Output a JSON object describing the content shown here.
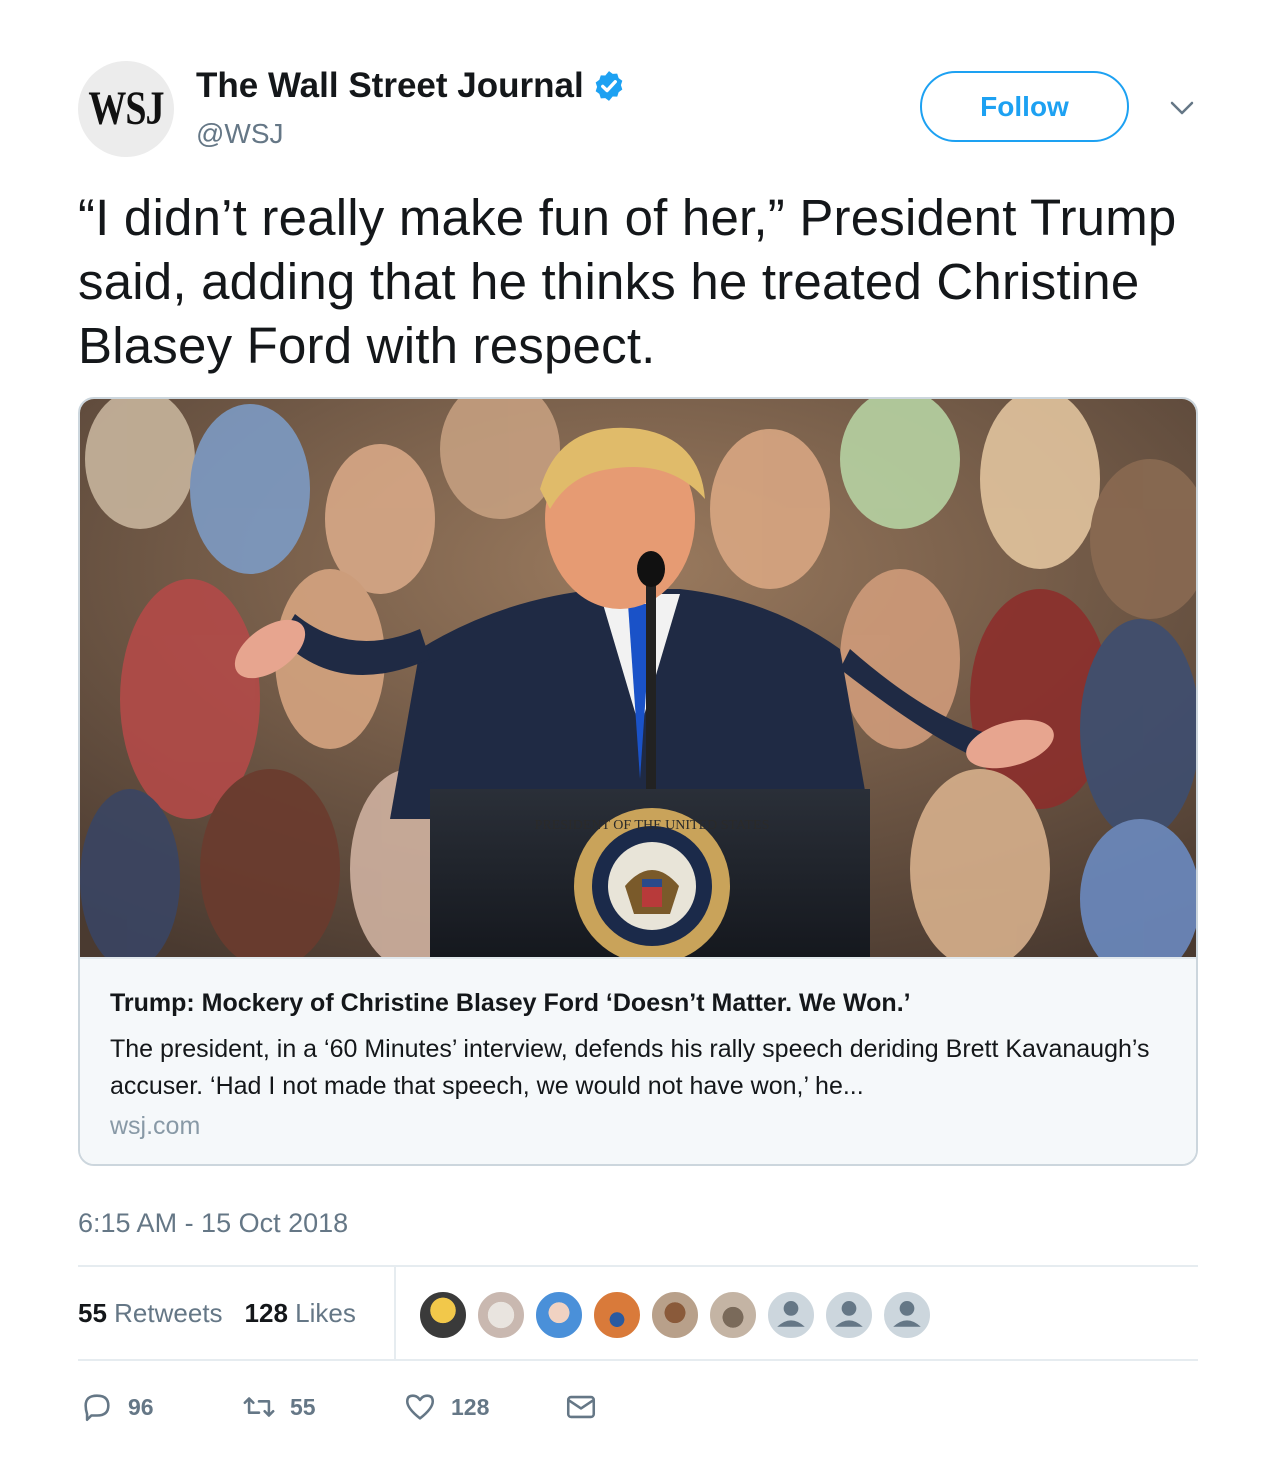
{
  "account": {
    "avatar_text": "WSJ",
    "display_name": "The Wall Street Journal",
    "handle": "@WSJ",
    "verified": true,
    "follow_label": "Follow"
  },
  "tweet": {
    "text": "“I didn’t really make fun of her,” President Trump said, adding that he thinks he treated Christine Blasey Ford with respect.",
    "timestamp": "6:15 AM - 15 Oct 2018"
  },
  "card": {
    "title": "Trump: Mockery of Christine Blasey Ford ‘Doesn’t Matter. We Won.’",
    "description": "The president, in a ‘60 Minutes’ interview, defends his rally speech deriding Brett Kavanaugh’s accuser. ‘Had I not made that speech, we would not have won,’ he...",
    "domain": "wsj.com",
    "seal_text": "PRESIDENT OF THE UNITED STATES"
  },
  "stats": {
    "retweets_count": "55",
    "retweets_label": "Retweets",
    "likes_count": "128",
    "likes_label": "Likes"
  },
  "actions": {
    "replies": "96",
    "retweets": "55",
    "likes": "128"
  },
  "colors": {
    "accent": "#1da1f2",
    "muted": "#657786",
    "text": "#14171a"
  },
  "icons": [
    "verified-badge-icon",
    "chevron-down-icon",
    "reply-icon",
    "retweet-icon",
    "like-icon",
    "message-icon",
    "default-avatar-icon"
  ]
}
